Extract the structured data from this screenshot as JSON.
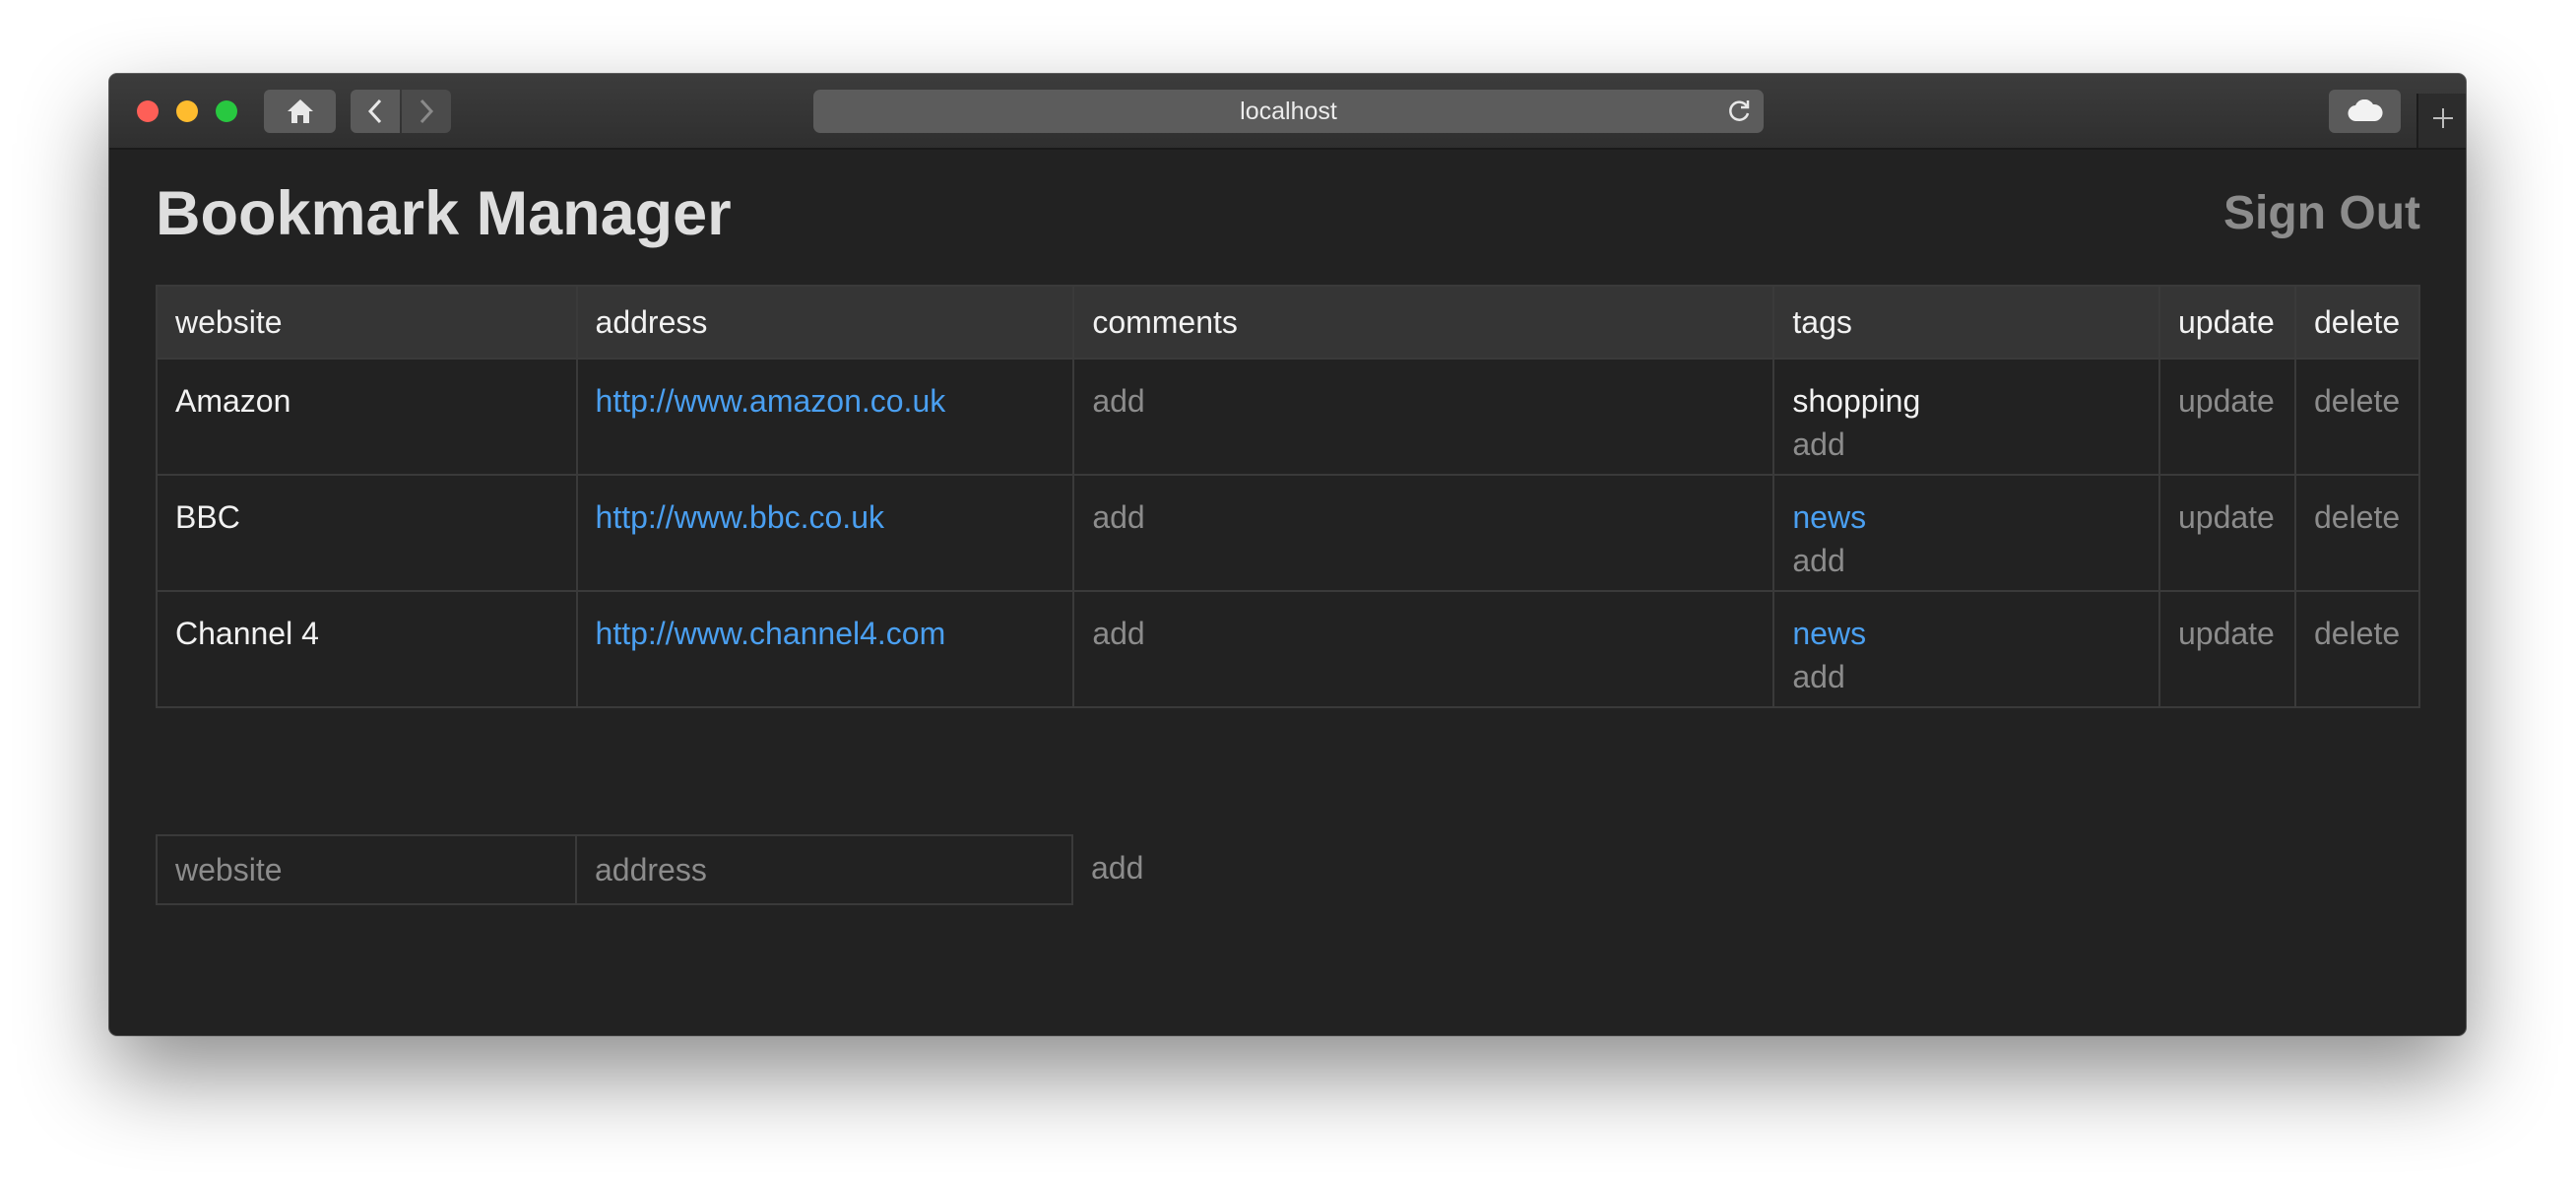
{
  "browser": {
    "url": "localhost",
    "icons": {
      "home": "home-icon",
      "back": "chevron-left-icon",
      "forward": "chevron-right-icon",
      "reload": "reload-icon",
      "cloud": "cloud-icon",
      "new_tab": "plus-icon"
    }
  },
  "header": {
    "title": "Bookmark Manager",
    "sign_out": "Sign Out"
  },
  "table": {
    "headers": [
      "website",
      "address",
      "comments",
      "tags",
      "update",
      "delete"
    ],
    "rows": [
      {
        "website": "Amazon",
        "address": "http://www.amazon.co.uk",
        "comments_action": "add",
        "tag": "shopping",
        "tag_action": "add",
        "update": "update",
        "delete": "delete"
      },
      {
        "website": "BBC",
        "address": "http://www.bbc.co.uk",
        "comments_action": "add",
        "tag": "news",
        "tag_action": "add",
        "update": "update",
        "delete": "delete"
      },
      {
        "website": "Channel 4",
        "address": "http://www.channel4.com",
        "comments_action": "add",
        "tag": "news",
        "tag_action": "add",
        "update": "update",
        "delete": "delete"
      }
    ]
  },
  "add_form": {
    "website_placeholder": "website",
    "website_value": "",
    "address_placeholder": "address",
    "address_value": "",
    "submit": "add"
  },
  "colors": {
    "background": "#222222",
    "link": "#4a9ff0",
    "muted": "#8c8c8c",
    "header_cell": "#353535"
  }
}
